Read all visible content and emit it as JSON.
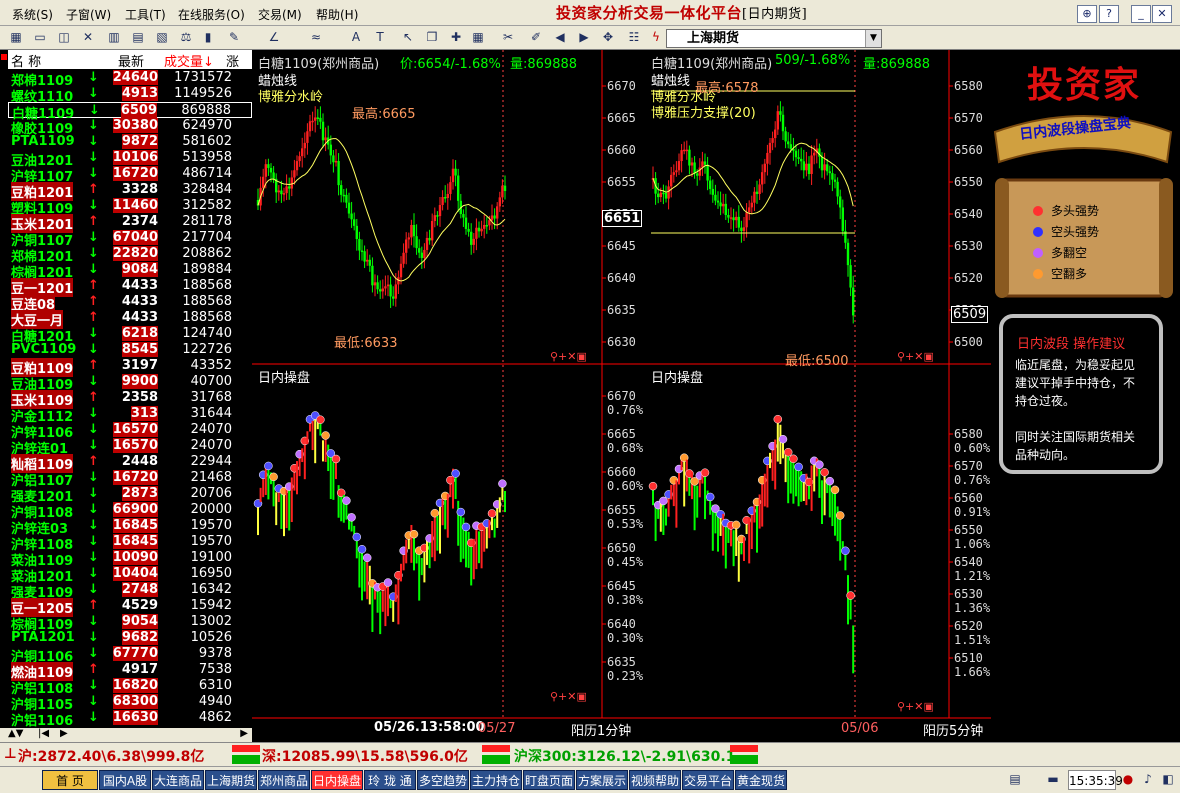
{
  "menu": {
    "items": [
      "系统(S)",
      "子窗(W)",
      "工具(T)",
      "在线服务(O)",
      "交易(M)",
      "帮助(H)"
    ]
  },
  "app": {
    "title": "投资家分析交易一体化平台",
    "subtitle": "[日内期货]"
  },
  "toolbar": {
    "exchange": "上海期货"
  },
  "quotes": {
    "headers": {
      "name": "名  称",
      "latest": "最新",
      "volume": "成交量↓",
      "extra": "涨"
    },
    "rows": [
      {
        "name": "郑棉1109",
        "dir": "↓",
        "price": "24640",
        "vol": "1731572",
        "up": false
      },
      {
        "name": "螺纹1110",
        "dir": "↓",
        "price": "4913",
        "vol": "1149526",
        "up": false
      },
      {
        "name": "白糖1109",
        "dir": "↓",
        "price": "6509",
        "vol": "869888",
        "up": false
      },
      {
        "name": "橡胶1109",
        "dir": "↓",
        "price": "30380",
        "vol": "624970",
        "up": false
      },
      {
        "name": "PTA1109",
        "dir": "↓",
        "price": "9872",
        "vol": "581602",
        "up": false
      },
      {
        "name": "豆油1201",
        "dir": "↓",
        "price": "10106",
        "vol": "513958",
        "up": false
      },
      {
        "name": "沪锌1107",
        "dir": "↓",
        "price": "16720",
        "vol": "486714",
        "up": false
      },
      {
        "name": "豆粕1201",
        "dir": "↑",
        "price": "3328",
        "vol": "328484",
        "up": true
      },
      {
        "name": "塑料1109",
        "dir": "↓",
        "price": "11460",
        "vol": "312582",
        "up": false
      },
      {
        "name": "玉米1201",
        "dir": "↑",
        "price": "2374",
        "vol": "281178",
        "up": true
      },
      {
        "name": "沪铜1107",
        "dir": "↓",
        "price": "67040",
        "vol": "217704",
        "up": false
      },
      {
        "name": "郑棉1201",
        "dir": "↓",
        "price": "22820",
        "vol": "208862",
        "up": false
      },
      {
        "name": "棕榈1201",
        "dir": "↓",
        "price": "9084",
        "vol": "189884",
        "up": false
      },
      {
        "name": "豆一1201",
        "dir": "↑",
        "price": "4433",
        "vol": "188568",
        "up": true
      },
      {
        "name": "豆连08",
        "dir": "↑",
        "price": "4433",
        "vol": "188568",
        "up": true
      },
      {
        "name": "大豆一月",
        "dir": "↑",
        "price": "4433",
        "vol": "188568",
        "up": true
      },
      {
        "name": "白糖1201",
        "dir": "↓",
        "price": "6218",
        "vol": "124740",
        "up": false
      },
      {
        "name": "PVC1109",
        "dir": "↓",
        "price": "8545",
        "vol": "122726",
        "up": false
      },
      {
        "name": "豆粕1109",
        "dir": "↑",
        "price": "3197",
        "vol": "43352",
        "up": true
      },
      {
        "name": "豆油1109",
        "dir": "↓",
        "price": "9900",
        "vol": "40700",
        "up": false
      },
      {
        "name": "玉米1109",
        "dir": "↑",
        "price": "2358",
        "vol": "31768",
        "up": true
      },
      {
        "name": "沪金1112",
        "dir": "↓",
        "price": "313",
        "vol": "31644",
        "up": false
      },
      {
        "name": "沪锌1106",
        "dir": "↓",
        "price": "16570",
        "vol": "24070",
        "up": false
      },
      {
        "name": "沪锌连01",
        "dir": "↓",
        "price": "16570",
        "vol": "24070",
        "up": false
      },
      {
        "name": "籼稻1109",
        "dir": "↑",
        "price": "2448",
        "vol": "22944",
        "up": true
      },
      {
        "name": "沪铝1107",
        "dir": "↓",
        "price": "16720",
        "vol": "21468",
        "up": false
      },
      {
        "name": "强麦1201",
        "dir": "↓",
        "price": "2873",
        "vol": "20706",
        "up": false
      },
      {
        "name": "沪铜1108",
        "dir": "↓",
        "price": "66900",
        "vol": "20000",
        "up": false
      },
      {
        "name": "沪锌连03",
        "dir": "↓",
        "price": "16845",
        "vol": "19570",
        "up": false
      },
      {
        "name": "沪锌1108",
        "dir": "↓",
        "price": "16845",
        "vol": "19570",
        "up": false
      },
      {
        "name": "菜油1109",
        "dir": "↓",
        "price": "10090",
        "vol": "19100",
        "up": false
      },
      {
        "name": "菜油1201",
        "dir": "↓",
        "price": "10404",
        "vol": "16950",
        "up": false
      },
      {
        "name": "强麦1109",
        "dir": "↓",
        "price": "2748",
        "vol": "16342",
        "up": false
      },
      {
        "name": "豆一1205",
        "dir": "↑",
        "price": "4529",
        "vol": "15942",
        "up": true
      },
      {
        "name": "棕榈1109",
        "dir": "↓",
        "price": "9054",
        "vol": "13002",
        "up": false
      },
      {
        "name": "PTA1201",
        "dir": "↓",
        "price": "9682",
        "vol": "10526",
        "up": false
      },
      {
        "name": "沪铜1106",
        "dir": "↓",
        "price": "67770",
        "vol": "9378",
        "up": false
      },
      {
        "name": "燃油1109",
        "dir": "↑",
        "price": "4917",
        "vol": "7538",
        "up": true
      },
      {
        "name": "沪铝1108",
        "dir": "↓",
        "price": "16820",
        "vol": "6310",
        "up": false
      },
      {
        "name": "沪铜1105",
        "dir": "↓",
        "price": "68300",
        "vol": "4940",
        "up": false
      },
      {
        "name": "沪铝1106",
        "dir": "↓",
        "price": "16630",
        "vol": "4862",
        "up": false
      }
    ]
  },
  "left_chart": {
    "header": "白糖1109(郑州商品)",
    "price_line": "价:6654/-1.68%",
    "vol_line": "量:869888",
    "label1": "蜡烛线",
    "label2": "博雅分水岭",
    "high_label": "最高:6665",
    "low_label": "最低:6633",
    "current_tag": "6651",
    "y_ticks": [
      "6670",
      "6665",
      "6660",
      "6655",
      "6650",
      "6645",
      "6640",
      "6635",
      "6630"
    ],
    "lower_title": "日内操盘",
    "lower_ticks": [
      "6670",
      "6665",
      "6660",
      "6655",
      "6650",
      "6645",
      "6640",
      "6635"
    ],
    "lower_pct": [
      "0.76%",
      "0.68%",
      "0.60%",
      "0.53%",
      "0.45%",
      "0.38%",
      "0.30%",
      "0.23%"
    ],
    "date_label": "05/26.13:58:00",
    "date_small": "05/27",
    "period": "阳历1分钟"
  },
  "right_chart": {
    "header": "白糖1109(郑州商品)",
    "price_line": "509/-1.68%",
    "vol_line": "量:869888",
    "label1": "蜡烛线",
    "label2": "博雅分水岭",
    "label3": "博雅压力支撑(20)",
    "high_label": "最高:6578",
    "low_label": "最低:6500",
    "current_tag": "6509",
    "y_ticks": [
      "6580",
      "6570",
      "6560",
      "6550",
      "6540",
      "6530",
      "6520",
      "6510",
      "6500"
    ],
    "lower_title": "日内操盘",
    "lower_ticks": [
      "6580",
      "6570",
      "6560",
      "6550",
      "6540",
      "6530",
      "6520",
      "6510"
    ],
    "lower_pct": [
      "0.60%",
      "0.76%",
      "0.91%",
      "1.06%",
      "1.21%",
      "1.36%",
      "1.51%",
      "1.66%"
    ],
    "date_small": "05/06",
    "period": "阳历5分钟"
  },
  "ad": {
    "logo": "投资家",
    "banner": "日内波段操盘宝典",
    "legend": [
      {
        "label": "多头强势",
        "color": "#ff3030"
      },
      {
        "label": "空头强势",
        "color": "#3030ff"
      },
      {
        "label": "多翻空",
        "color": "#c060ff"
      },
      {
        "label": "空翻多",
        "color": "#ff9a30"
      }
    ],
    "advice_title": "日内波段  操作建议",
    "advice_p1": "临近尾盘，为稳妥起见建议平掉手中持仓，不持仓过夜。",
    "advice_p2": "同时关注国际期货相关品种动向。"
  },
  "status": {
    "sh": "沪:2872.40\\6.38\\999.8亿",
    "sz": "深:12085.99\\15.58\\596.0亿",
    "hs300": "沪深300:3126.12\\-2.91\\630.1"
  },
  "tabs": [
    "首 页",
    "国内A股",
    "大连商品",
    "上海期货",
    "郑州商品",
    "日内操盘",
    "玲 珑 通",
    "多空趋势",
    "主力持仓",
    "盯盘页面",
    "方案展示",
    "视频帮助",
    "交易平台",
    "黄金现货"
  ],
  "clock": "15:35:39",
  "colors": {
    "up": "#ff2020",
    "down": "#00ff00",
    "ma": "#ffff60",
    "axis": "#ff0000",
    "highlow": "#ff9a60"
  }
}
